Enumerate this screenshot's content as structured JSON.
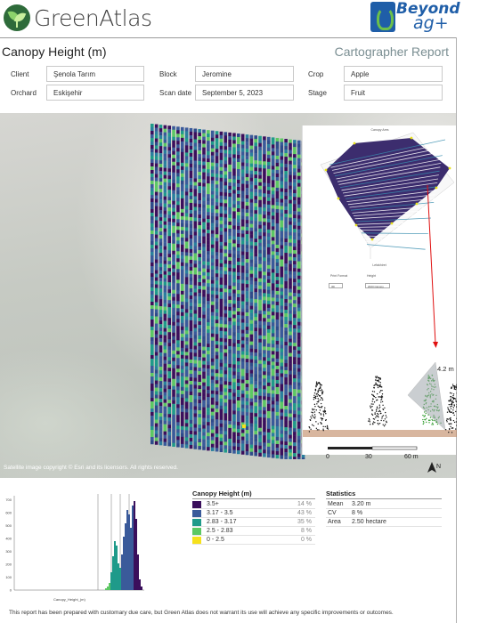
{
  "header": {
    "brand": "GreenAtlas",
    "partner_line1": "Beyond",
    "partner_line2": "ag+",
    "report_title": "Canopy Height (m)",
    "report_type": "Cartographer Report"
  },
  "fields": {
    "client_label": "Client",
    "client_value": "Şenola Tarım",
    "orchard_label": "Orchard",
    "orchard_value": "Eskişehir",
    "block_label": "Block",
    "block_value": "Jeromine",
    "scan_date_label": "Scan date",
    "scan_date_value": "September 5, 2023",
    "crop_label": "Crop",
    "crop_value": "Apple",
    "stage_label": "Stage",
    "stage_value": "Fruit"
  },
  "map": {
    "copyright": "Satellite image copyright © Esri and its licensors. All rights reserved.",
    "scale_labels": [
      "0",
      "30",
      "60 m"
    ],
    "north_label": "N",
    "inset_height_label": "4.2 m",
    "inset_title": "Canopy Ares",
    "inset_mid_label": "Lefakhiret",
    "inset_select1_label": "Print Format",
    "inset_select1_value": "3D",
    "inset_select2_label": "Height",
    "inset_select2_value": "2023 Canopy"
  },
  "legend": {
    "title": "Canopy Height (m)",
    "rows": [
      {
        "range": "3.5+",
        "pct": "14 %",
        "color": "#3b0f5c"
      },
      {
        "range": "3.17 - 3.5",
        "pct": "43 %",
        "color": "#3a5a9a"
      },
      {
        "range": "2.83 - 3.17",
        "pct": "35 %",
        "color": "#1f9a8a"
      },
      {
        "range": "2.5 - 2.83",
        "pct": "8 %",
        "color": "#5cc863"
      },
      {
        "range": "0 - 2.5",
        "pct": "0 %",
        "color": "#f6e11c"
      }
    ]
  },
  "statistics": {
    "title": "Statistics",
    "rows": [
      {
        "label": "Mean",
        "value": "3.20 m"
      },
      {
        "label": "CV",
        "value": "8 %"
      },
      {
        "label": "Area",
        "value": "2.50 hectare"
      }
    ]
  },
  "histogram": {
    "xlabel": "Canopy_Height_(m)",
    "y_ticks": [
      "700",
      "600",
      "500",
      "400",
      "300",
      "200",
      "100",
      "0"
    ]
  },
  "disclaimer": "This report has been prepared with customary due care, but Green Atlas does not warrant its use will achieve any specific improvements or outcomes."
}
